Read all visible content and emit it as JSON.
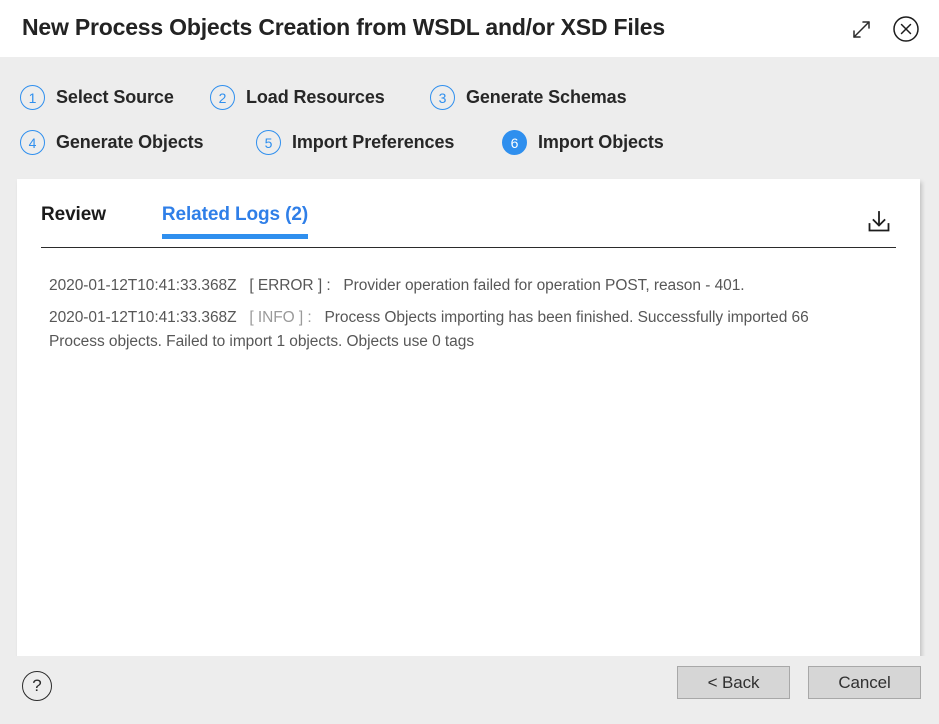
{
  "window": {
    "title": "New Process Objects Creation from WSDL and/or XSD Files",
    "expand_icon": "expand-diagonal-icon",
    "close_icon": "close-circle-icon",
    "accent_color": "#2f8fee",
    "background_color": "#ededed",
    "panel_color": "#ffffff"
  },
  "steps": [
    {
      "number": "1",
      "label": "Select Source",
      "active": false
    },
    {
      "number": "2",
      "label": "Load Resources",
      "active": false
    },
    {
      "number": "3",
      "label": "Generate Schemas",
      "active": false
    },
    {
      "number": "4",
      "label": "Generate Objects",
      "active": false
    },
    {
      "number": "5",
      "label": "Import Preferences",
      "active": false
    },
    {
      "number": "6",
      "label": "Import Objects",
      "active": true
    }
  ],
  "tabs": [
    {
      "label": "Review",
      "active": false
    },
    {
      "label": "Related Logs (2)",
      "active": true
    }
  ],
  "toolbar": {
    "download_icon": "download-icon"
  },
  "logs": [
    {
      "timestamp": "2020-01-12T10:41:33.368Z",
      "level": "[ ERROR ] :",
      "message": "Provider operation failed for operation POST, reason - 401."
    },
    {
      "timestamp": "2020-01-12T10:41:33.368Z",
      "level": "[ INFO ] :",
      "message": "Process Objects importing has been finished. Successfully imported 66 Process objects. Failed to import 1 objects. Objects use 0 tags"
    }
  ],
  "footer": {
    "help_label": "?",
    "back_label": "< Back",
    "cancel_label": "Cancel"
  }
}
